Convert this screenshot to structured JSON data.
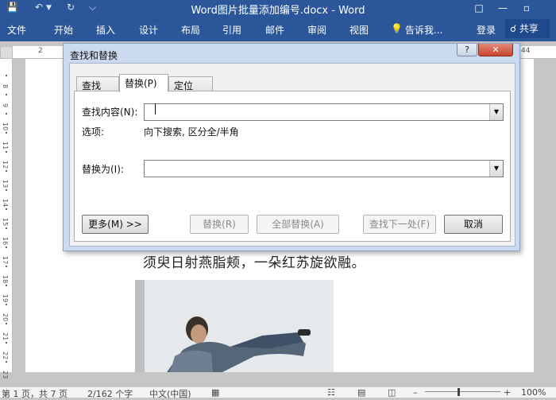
{
  "titlebar": {
    "title": "Word图片批量添加编号.docx - Word",
    "minimize_label": "—",
    "restore_label": "▫"
  },
  "ribbon": {
    "tabs": [
      "文件",
      "开始",
      "插入",
      "设计",
      "布局",
      "引用",
      "邮件",
      "审阅",
      "视图"
    ],
    "tell_me": "告诉我...",
    "login": "登录",
    "share": "共享"
  },
  "ruler": {
    "top_marks": [
      "2",
      "44"
    ],
    "left_marks": [
      "8",
      "9",
      "10",
      "11",
      "12",
      "13",
      "14",
      "15",
      "16",
      "17",
      "18",
      "19",
      "20",
      "21",
      "22",
      "23"
    ]
  },
  "document": {
    "text_line": "须臾日射燕脂颊，一朵红苏旋欲融。"
  },
  "dialog": {
    "title": "查找和替换",
    "help_label": "?",
    "close_label": "✕",
    "tabs": [
      "查找(D)",
      "替换(P)",
      "定位(G)"
    ],
    "find_label": "查找内容(N):",
    "find_value": "",
    "options_label": "选项:",
    "options_value": "向下搜索, 区分全/半角",
    "replace_label": "替换为(I):",
    "replace_value": "",
    "more_button": "更多(M) >>",
    "replace_button": "替换(R)",
    "replace_all_button": "全部替换(A)",
    "find_next_button": "查找下一处(F)",
    "cancel_button": "取消"
  },
  "statusbar": {
    "page": "第 1 页，共 7 页",
    "words": "2/162 个字",
    "language": "中文(中国)",
    "zoom": "100%"
  },
  "colors": {
    "ribbon": "#2b579a",
    "dialog_frame": "#ccdaf0",
    "close_button": "#c8452e"
  }
}
